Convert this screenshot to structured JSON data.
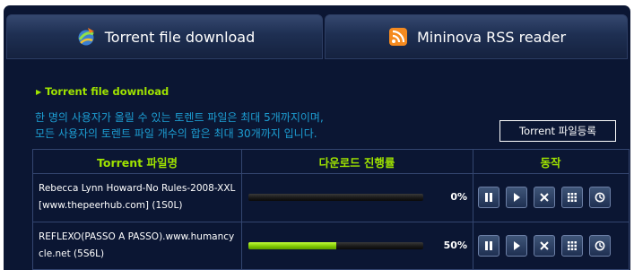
{
  "tabs": [
    {
      "label": "Torrent file download",
      "icon": "torrent-download-icon"
    },
    {
      "label": "Mininova RSS reader",
      "icon": "rss-icon"
    }
  ],
  "section": {
    "title": "Torrent file download",
    "notice_line1": "한 명의 사용자가 올릴 수 있는 토렌트 파일은 최대 5개까지이며,",
    "notice_line2": "모든 사용자의 토렌트 파일 개수의 합은 최대 30개까지 입니다.",
    "register_button": "Torrent 파일등록"
  },
  "table": {
    "headers": {
      "name": "Torrent 파일명",
      "progress": "다운로드 진행률",
      "action": "동작"
    },
    "rows": [
      {
        "name": "Rebecca Lynn Howard-No Rules-2008-XXL [www.thepeerhub.com] (1S0L)",
        "progress": 0,
        "progress_label": "0%"
      },
      {
        "name": "REFLEXO(PASSO A PASSO).www.humancycle.net (5S6L)",
        "progress": 50,
        "progress_label": "50%"
      }
    ],
    "actions": [
      "pause-icon",
      "play-icon",
      "stop-icon",
      "grid-icon",
      "status-icon"
    ]
  },
  "colors": {
    "background": "#0b1633",
    "accent_green": "#9fe300",
    "notice_blue": "#1d9fd4"
  }
}
